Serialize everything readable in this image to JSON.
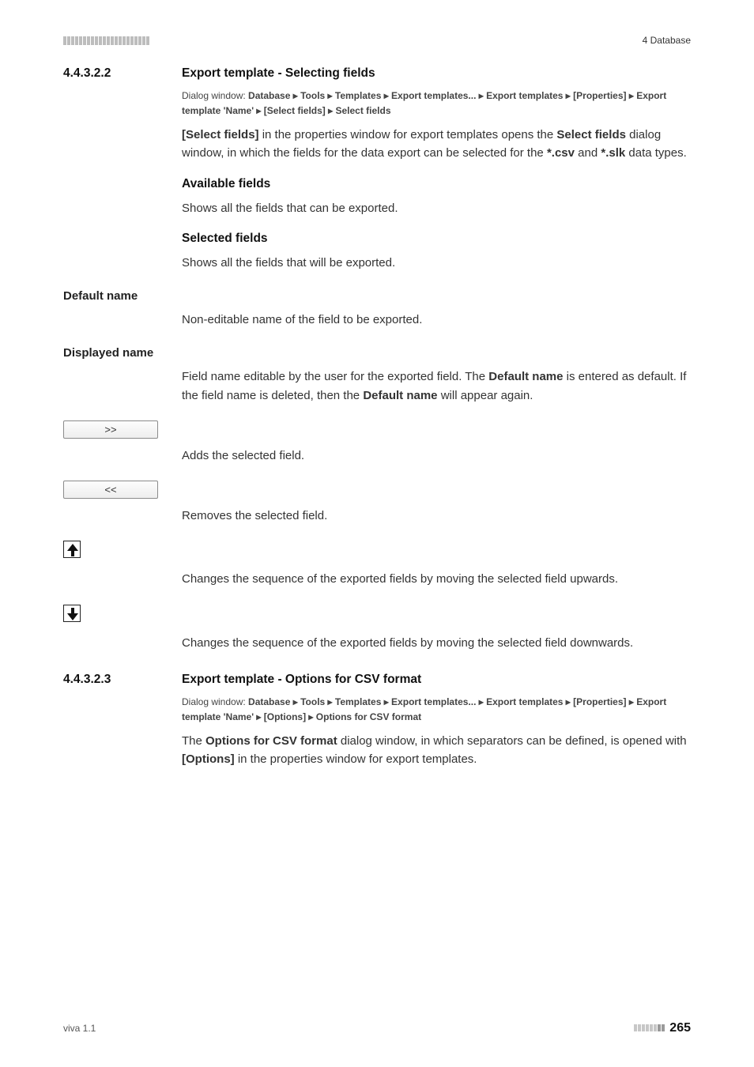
{
  "header": {
    "chapter": "4 Database"
  },
  "s1": {
    "num": "4.4.3.2.2",
    "title": "Export template - Selecting fields",
    "path_lead": "Dialog window: ",
    "path_bold": "Database ▸ Tools ▸ Templates ▸ Export templates... ▸ Export templates ▸ [Properties] ▸ Export template 'Name' ▸ [Select fields] ▸ Select fields",
    "p1a": "[Select fields]",
    "p1b": " in the properties window for export templates opens the ",
    "p1c": "Select fields",
    "p1d": " dialog window, in which the fields for the data export can be selected for the ",
    "p1e": "*.csv",
    "p1f": " and ",
    "p1g": "*.slk",
    "p1h": " data types.",
    "sub_avail": "Available fields",
    "avail_text": "Shows all the fields that can be exported.",
    "sub_sel": "Selected fields",
    "sel_text": "Shows all the fields that will be exported."
  },
  "terms": {
    "default_name": {
      "label": "Default name",
      "text": "Non-editable name of the field to be exported."
    },
    "displayed_name": {
      "label": "Displayed name",
      "a": "Field name editable by the user for the exported field. The ",
      "b": "Default name",
      "c": " is entered as default. If the field name is deleted, then the ",
      "d": "Default name",
      "e": " will appear again."
    },
    "add": {
      "btn": ">>",
      "text": "Adds the selected field."
    },
    "remove": {
      "btn": "<<",
      "text": "Removes the selected field."
    },
    "up": {
      "text": "Changes the sequence of the exported fields by moving the selected field upwards."
    },
    "down": {
      "text": "Changes the sequence of the exported fields by moving the selected field downwards."
    }
  },
  "s2": {
    "num": "4.4.3.2.3",
    "title": "Export template - Options for CSV format",
    "path_lead": "Dialog window: ",
    "path_bold": "Database ▸ Tools ▸ Templates ▸ Export templates... ▸ Export templates ▸ [Properties] ▸ Export template 'Name' ▸ [Options] ▸ Options for CSV format",
    "p_a": "The ",
    "p_b": "Options for CSV format",
    "p_c": " dialog window, in which separators can be defined, is opened with ",
    "p_d": "[Options]",
    "p_e": " in the properties window for export templates."
  },
  "footer": {
    "version": "viva 1.1",
    "page": "265"
  }
}
